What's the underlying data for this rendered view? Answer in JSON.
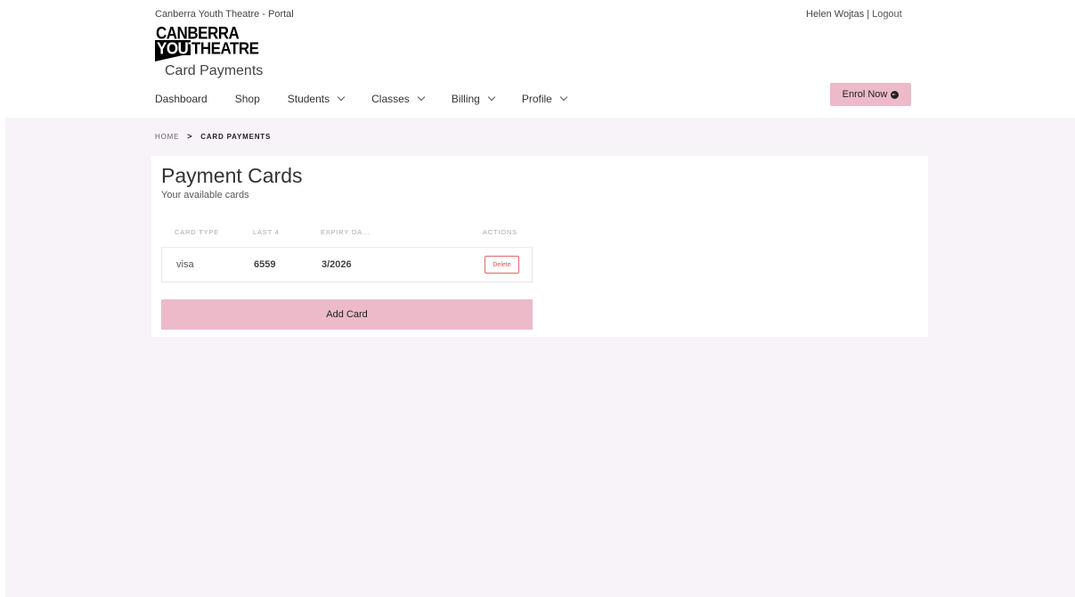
{
  "header": {
    "portal_title": "Canberra Youth Theatre - Portal",
    "user_name": "Helen Wojtas",
    "separator": "|",
    "logout_label": "Logout",
    "logo": {
      "line1": "CANBERRA",
      "line2a": "YOUTH",
      "line2b": "THEATRE"
    },
    "page_subtitle": "Card Payments",
    "enrol_label": "Enrol Now"
  },
  "nav": {
    "items": [
      {
        "label": "Dashboard",
        "has_dropdown": false
      },
      {
        "label": "Shop",
        "has_dropdown": false
      },
      {
        "label": "Students",
        "has_dropdown": true
      },
      {
        "label": "Classes",
        "has_dropdown": true
      },
      {
        "label": "Billing",
        "has_dropdown": true
      },
      {
        "label": "Profile",
        "has_dropdown": true
      }
    ]
  },
  "breadcrumb": {
    "home": "HOME",
    "separator": ">",
    "current": "CARD PAYMENTS"
  },
  "panel": {
    "title": "Payment Cards",
    "subtitle": "Your available cards",
    "columns": {
      "card_type": "CARD TYPE",
      "last4": "LAST 4",
      "expiry": "EXPIRY DA...",
      "actions": "ACTIONS"
    },
    "rows": [
      {
        "card_type": "visa",
        "last4": "6559",
        "expiry": "3/2026",
        "delete_label": "Delete"
      }
    ],
    "add_card_label": "Add Card"
  },
  "colors": {
    "accent_pink": "#ecbac8",
    "band_background": "#f8f2f9",
    "delete_red": "#e05050"
  }
}
